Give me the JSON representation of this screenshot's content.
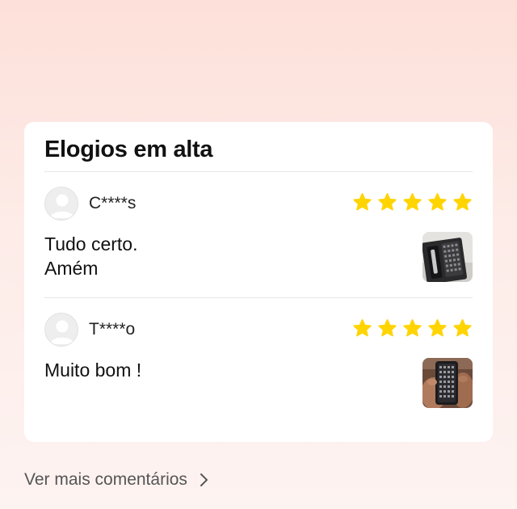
{
  "section": {
    "title": "Elogios em alta"
  },
  "reviews": [
    {
      "user": "C****s",
      "rating": 5,
      "max_rating": 5,
      "text": "Tudo certo.\nAmém",
      "photo_icon": "product-photo-screwdriver-kit"
    },
    {
      "user": "T****o",
      "rating": 5,
      "max_rating": 5,
      "text": "Muito bom !",
      "photo_icon": "product-photo-screwdriver-case-in-hand"
    }
  ],
  "footer": {
    "more_label": "Ver mais comentários",
    "more_icon": "chevron-right-icon"
  },
  "colors": {
    "star": "#ffd400",
    "card_background": "#ffffff",
    "page_gradient_top": "#fde0d9",
    "page_gradient_bottom": "#fdf3f1"
  }
}
